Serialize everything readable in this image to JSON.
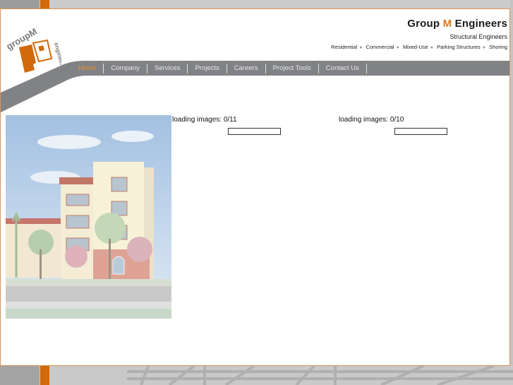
{
  "brand": {
    "title_prefix": "Group ",
    "title_accent": "M",
    "title_suffix": " Engineers",
    "subtitle": "Structural Engineers",
    "tags": [
      "Residential",
      "Commercial",
      "Mixed-Use",
      "Parking Structures",
      "Shoring"
    ],
    "accent_color": "#d97a1c"
  },
  "logo": {
    "top_text": "groupM",
    "side_text": "engineers"
  },
  "nav": {
    "items": [
      {
        "label": "Home",
        "active": true
      },
      {
        "label": "Company",
        "active": false
      },
      {
        "label": "Services",
        "active": false
      },
      {
        "label": "Projects",
        "active": false
      },
      {
        "label": "Careers",
        "active": false
      },
      {
        "label": "Project Tools",
        "active": false
      },
      {
        "label": "Contact Us",
        "active": false
      }
    ]
  },
  "hero_image": {
    "alt": "Rendering of multi-story residential building with palm trees"
  },
  "loaders": [
    {
      "label": "loading images: 0/11",
      "loaded": 0,
      "total": 11
    },
    {
      "label": "loading images: 0/10",
      "loaded": 0,
      "total": 10
    }
  ]
}
